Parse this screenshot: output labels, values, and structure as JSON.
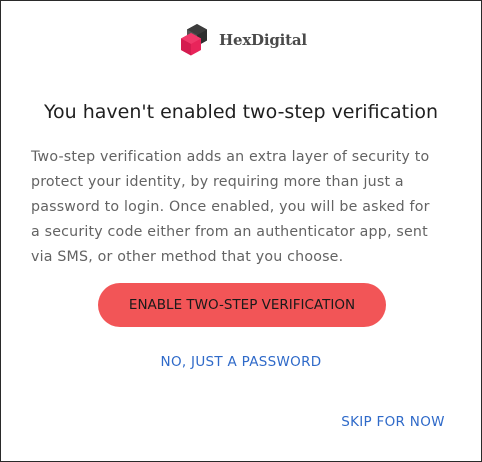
{
  "brand": {
    "name": "HexDigital",
    "logo_icon": "hexagon-cube-icon",
    "logo_colors": {
      "pink": "#e8245a",
      "dark": "#3c3c3c",
      "mid": "#555555"
    }
  },
  "dialog": {
    "title": "You haven't enabled two-step verification",
    "description_lines": [
      "Two-step verification adds an extra layer of security to",
      "protect your identity, by requiring more than just a",
      "password to login. Once enabled, you will be asked for",
      "a security code either from an authenticator app, sent",
      "via SMS, or other method that you choose."
    ]
  },
  "actions": {
    "enable_label": "ENABLE TWO-STEP VERIFICATION",
    "password_only_label": "NO, JUST A PASSWORD",
    "skip_label": "SKIP FOR NOW"
  },
  "colors": {
    "primary_button": "#f25557",
    "link": "#2f6ac9",
    "body_text": "#636363",
    "title_text": "#1f1f1f"
  }
}
